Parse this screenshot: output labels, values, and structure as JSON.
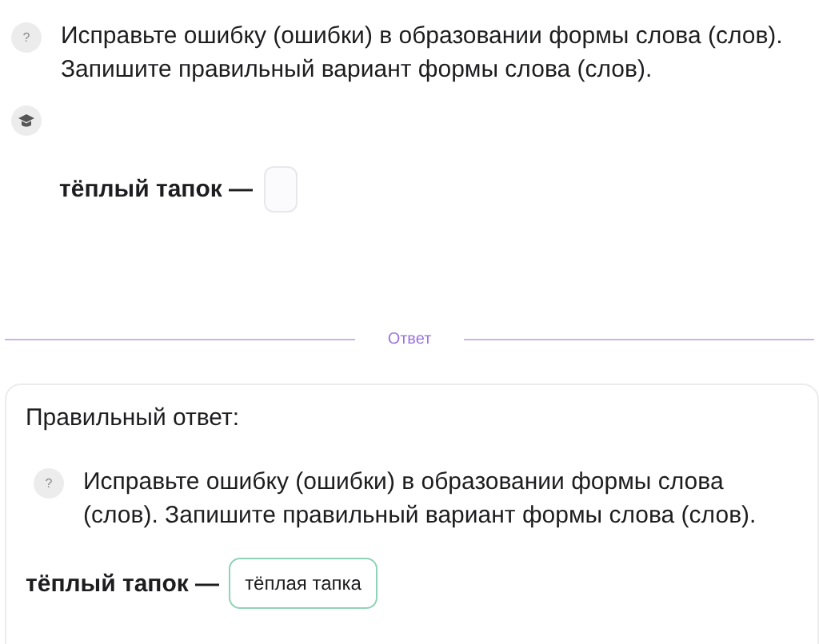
{
  "question": {
    "text": "Исправьте ошибку (ошибки) в образовании формы слова (слов). Запишите правильный вариант формы слова (слов).",
    "help": "?"
  },
  "task": {
    "label": "тёплый тапок —"
  },
  "divider": {
    "label": "Ответ"
  },
  "answer_card": {
    "title": "Правильный ответ:",
    "help": "?",
    "question": "Исправьте ошибку (ошибки) в образовании формы слова (слов). Запишите правильный вариант формы слова (слов).",
    "label": "тёплый тапок —",
    "value": "тёплая тапка"
  }
}
